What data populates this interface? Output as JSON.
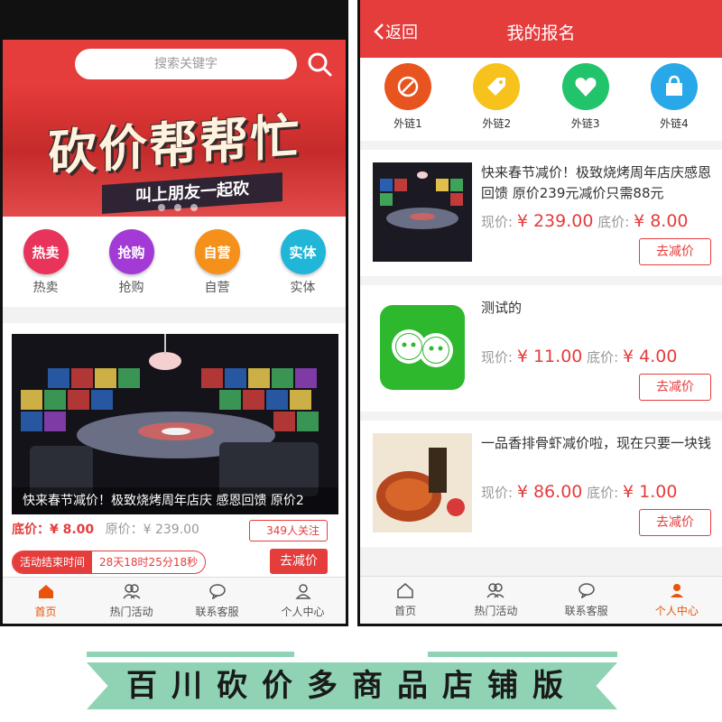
{
  "left": {
    "search_placeholder": "搜索关键字",
    "banner_title": "砍价帮帮忙",
    "banner_subtitle": "叫上朋友一起砍",
    "categories": [
      {
        "badge": "热卖",
        "label": "热卖",
        "color": "#e8335a"
      },
      {
        "badge": "抢购",
        "label": "抢购",
        "color": "#a33ad6"
      },
      {
        "badge": "自营",
        "label": "自营",
        "color": "#f5901a"
      },
      {
        "badge": "实体",
        "label": "实体",
        "color": "#1fb6d8"
      }
    ],
    "deal": {
      "caption": "快来春节减价！极致烧烤周年店庆 感恩回馈 原价2",
      "floor_price": "底价：¥ 8.00",
      "original_price": "原价：¥ 239.00",
      "followers": "349人关注",
      "timer_label": "活动结束时间",
      "timer_value": "28天18时25分18秒",
      "button": "去减价"
    },
    "tabbar": [
      {
        "label": "首页",
        "icon": "home-icon"
      },
      {
        "label": "热门活动",
        "icon": "users-icon"
      },
      {
        "label": "联系客服",
        "icon": "chat-icon"
      },
      {
        "label": "个人中心",
        "icon": "user-icon"
      }
    ]
  },
  "right": {
    "back_label": "返回",
    "title": "我的报名",
    "links": [
      {
        "label": "外链1",
        "color": "#e8541f",
        "icon": "food-icon"
      },
      {
        "label": "外链2",
        "color": "#f6c21b",
        "icon": "tag-icon"
      },
      {
        "label": "外链3",
        "color": "#21c36b",
        "icon": "heart-icon"
      },
      {
        "label": "外链4",
        "color": "#28a8e8",
        "icon": "bag-icon"
      }
    ],
    "items": [
      {
        "title": "快来春节减价！极致烧烤周年店庆感恩回馈 原价239元减价只需88元",
        "now_label": "现价:",
        "now": "¥ 239.00",
        "floor_label": "底价:",
        "floor": "¥ 8.00",
        "button": "去减价"
      },
      {
        "title": "测试的",
        "now_label": "现价:",
        "now": "¥ 11.00",
        "floor_label": "底价:",
        "floor": "¥ 4.00",
        "button": "去减价"
      },
      {
        "title": "一品香排骨虾减价啦，现在只要一块钱",
        "now_label": "现价:",
        "now": "¥ 86.00",
        "floor_label": "底价:",
        "floor": "¥ 1.00",
        "button": "去减价"
      }
    ],
    "tabbar": [
      {
        "label": "首页",
        "icon": "home-icon"
      },
      {
        "label": "热门活动",
        "icon": "users-icon"
      },
      {
        "label": "联系客服",
        "icon": "chat-icon"
      },
      {
        "label": "个人中心",
        "icon": "user-icon"
      }
    ]
  },
  "footer": {
    "text": "百川砍价多商品店铺版"
  },
  "colors": {
    "primary": "#e53c3c",
    "active_tab": "#e8540c",
    "footer_band": "#8fd3b4"
  }
}
